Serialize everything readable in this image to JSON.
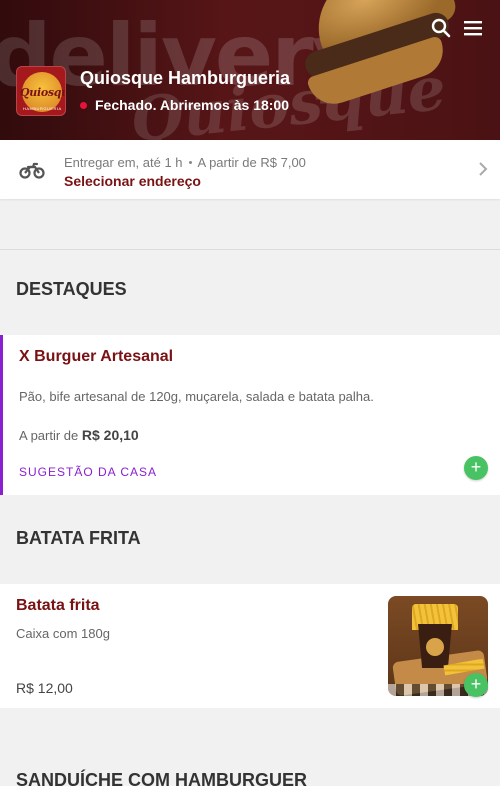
{
  "header": {
    "store_name": "Quiosque Hamburgueria",
    "status_text": "Fechado. Abriremos às 18:00",
    "status_color": "#e8123c",
    "watermark": "delivery",
    "logo_text": "Quiosque",
    "logo_subtext": "HAMBURGUERIA",
    "icons": [
      "search-icon",
      "menu-icon"
    ]
  },
  "delivery": {
    "time_text": "Entregar em, até 1 h",
    "fee_text": "A partir de R$ 7,00",
    "address_link": "Selecionar endereço"
  },
  "sections": [
    {
      "title": "DESTAQUES",
      "items": [
        {
          "name": "X Burguer Artesanal",
          "description": "Pão, bife artesanal de 120g, muçarela, salada e batata palha.",
          "price_prefix": "A partir de",
          "price": "R$ 20,10",
          "tag": "SUGESTÃO DA CASA"
        }
      ]
    },
    {
      "title": "BATATA FRITA",
      "items": [
        {
          "name": "Batata frita",
          "description": "Caixa com 180g",
          "price": "R$ 12,00"
        }
      ]
    },
    {
      "title": "SANDUÍCHE COM HAMBURGUER"
    }
  ],
  "colors": {
    "accent": "#7a1214",
    "highlight": "#8a1fd2",
    "add_button": "#48c262"
  }
}
